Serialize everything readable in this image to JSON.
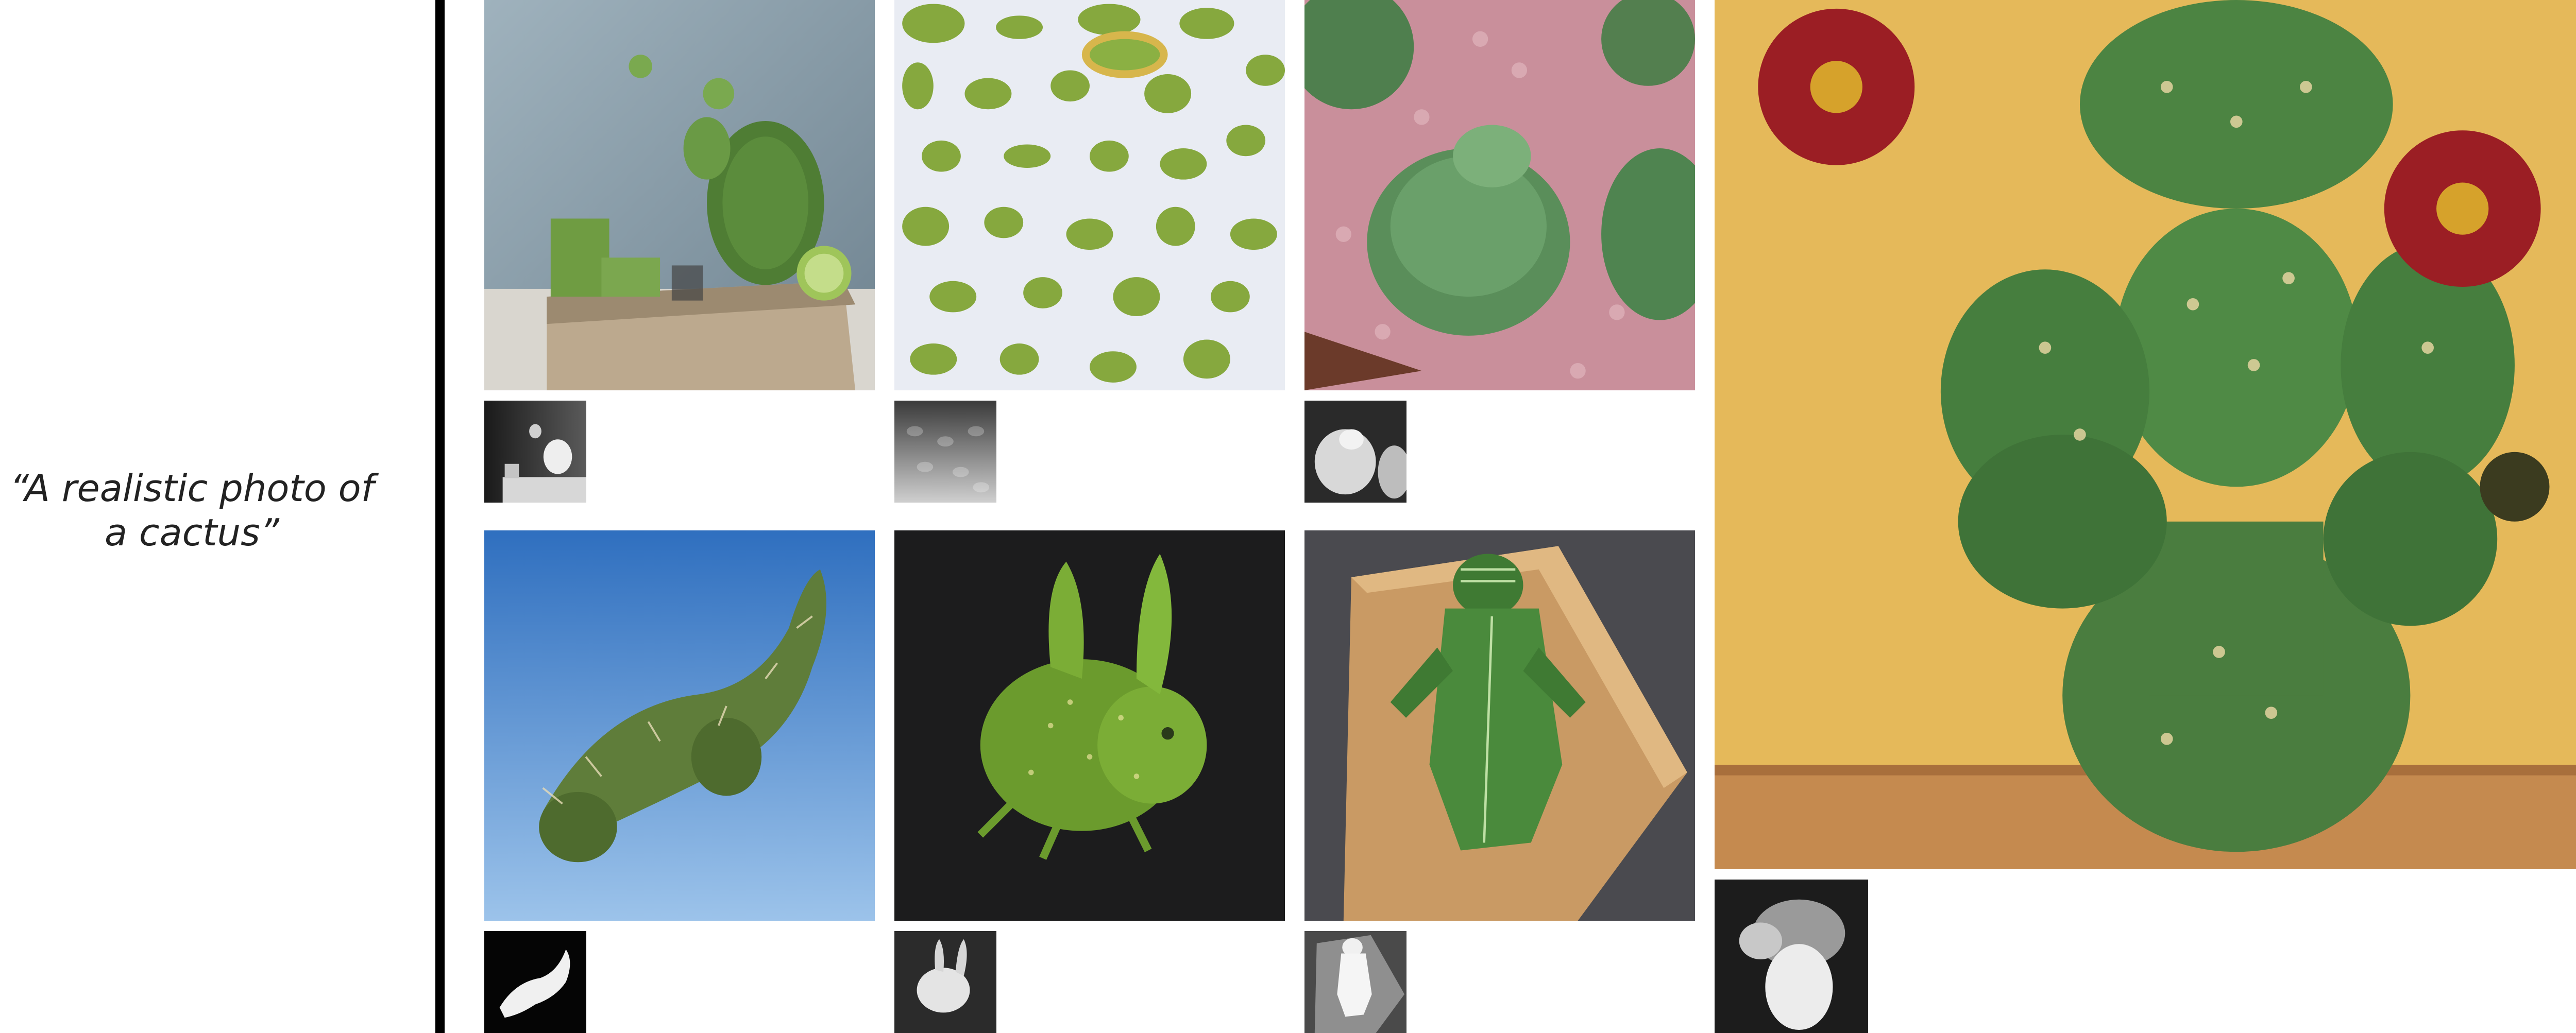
{
  "prompt": {
    "text": "“A realistic photo of a cactus”"
  }
}
